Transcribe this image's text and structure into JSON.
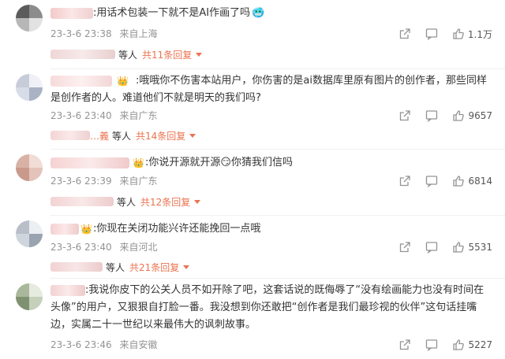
{
  "comments": [
    {
      "text": ":用话术包装一下就不是AI作画了吗",
      "emoji": "🥶",
      "date": "23-3-6 23:38",
      "location": "来自上海",
      "likes": "1.1万",
      "deng": "等人",
      "replies": "共11条回复"
    },
    {
      "text": ":哦哦你不伤害本站用户，你伤害的是ai数据库里原有图片的创作者，那些同样是创作者的人。难道他们不就是明天的我们吗?",
      "date": "23-3-6 23:40",
      "location": "来自广东",
      "likes": "9657",
      "reply_name": "…義",
      "deng": "等人",
      "replies": "共14条回复"
    },
    {
      "text": ":你说开源就开源",
      "emoji": "😏",
      "text2": "你猜我们信吗",
      "date": "23-3-6 23:39",
      "location": "来自广东",
      "likes": "6814",
      "deng": "等人",
      "replies": "共12条回复"
    },
    {
      "text": ":你现在关闭功能兴许还能挽回一点哦",
      "date": "23-3-6 23:40",
      "location": "来自河北",
      "likes": "5531",
      "deng": "等人",
      "replies": "共21条回复"
    },
    {
      "text": ":我说你皮下的公关人员不如开除了吧，这套话说的既侮辱了“没有绘画能力也没有时间在头像”的用户，又狠狠自打脸一番。我没想到你还敢把“创作者是我们最珍视的伙伴”这句话挂嘴边，实属二十一世纪以来最伟大的讽刺故事。",
      "date": "23-3-6 23:46",
      "location": "来自安徽",
      "likes": "5227"
    }
  ],
  "icons": {
    "share": "share-icon",
    "comment": "comment-icon",
    "like": "like-icon",
    "crown": "crown-icon"
  },
  "colors": {
    "accent": "#eb7350",
    "meta": "#939393"
  }
}
